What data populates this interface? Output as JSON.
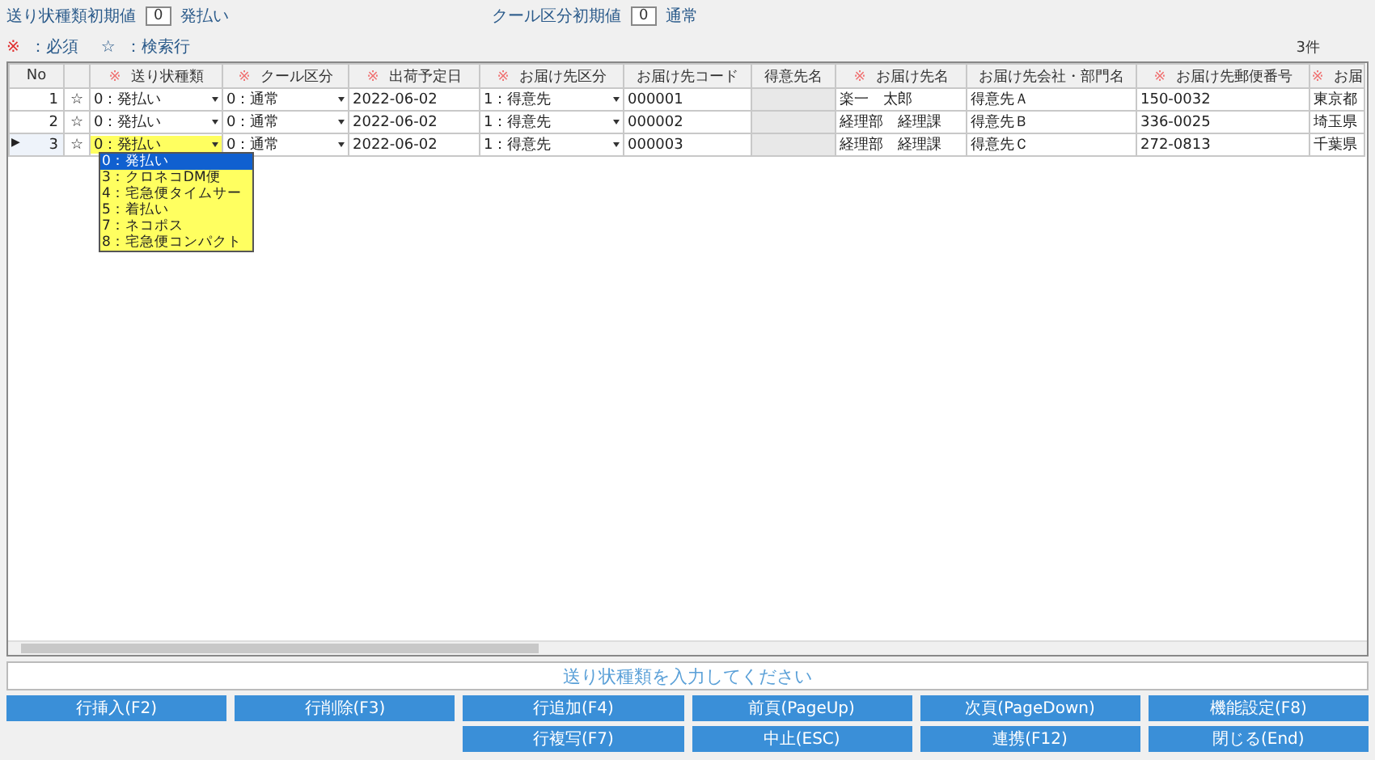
{
  "settings": [
    {
      "label": "送り状種類初期値",
      "value": "0",
      "text": "発払い"
    },
    {
      "label": "クール区分初期値",
      "value": "0",
      "text": "通常"
    }
  ],
  "legend": [
    {
      "mark": "※",
      "text": "：必須",
      "kind": "required"
    },
    {
      "mark": "☆",
      "text": "：検索行",
      "kind": "search"
    }
  ],
  "count": "3件",
  "current_marker": "▶",
  "columns": [
    {
      "label": "No"
    },
    {
      "label": "送り状種類",
      "mark": "※"
    },
    {
      "label": "クール区分",
      "mark": "※"
    },
    {
      "label": "出荷予定日",
      "mark": "※"
    },
    {
      "label": "お届け先区分",
      "mark": "※"
    },
    {
      "label": "お届け先コード"
    },
    {
      "label": "得意先名"
    },
    {
      "label": "お届け先名",
      "mark": "※"
    },
    {
      "label": "お届け先会社・部門名"
    },
    {
      "label": "お届け先郵便番号",
      "mark": "※"
    },
    {
      "label": "お届",
      "mark": "※"
    }
  ],
  "rows": [
    {
      "no": "1",
      "star": "☆",
      "selected": false,
      "cells": [
        {
          "text": "0：発払い",
          "kind": "combo"
        },
        {
          "text": "0：通常",
          "kind": "combo"
        },
        {
          "text": "2022-06-02",
          "kind": "text"
        },
        {
          "text": "1：得意先",
          "kind": "combo"
        },
        {
          "text": "000001",
          "kind": "text"
        },
        {
          "kind": "readonly"
        },
        {
          "text": "楽一　太郎",
          "kind": "text"
        },
        {
          "text": "得意先Ａ",
          "kind": "text"
        },
        {
          "text": "150-0032",
          "kind": "text"
        },
        {
          "text": "東京都",
          "kind": "text"
        }
      ]
    },
    {
      "no": "2",
      "star": "☆",
      "selected": false,
      "cells": [
        {
          "text": "0：発払い",
          "kind": "combo"
        },
        {
          "text": "0：通常",
          "kind": "combo"
        },
        {
          "text": "2022-06-02",
          "kind": "text"
        },
        {
          "text": "1：得意先",
          "kind": "combo"
        },
        {
          "text": "000002",
          "kind": "text"
        },
        {
          "kind": "readonly"
        },
        {
          "text": "経理部　経理課",
          "kind": "text"
        },
        {
          "text": "得意先Ｂ",
          "kind": "text"
        },
        {
          "text": "336-0025",
          "kind": "text"
        },
        {
          "text": "埼玉県",
          "kind": "text"
        }
      ]
    },
    {
      "no": "3",
      "star": "☆",
      "selected": true,
      "cells": [
        {
          "text": "0：発払い",
          "kind": "editing"
        },
        {
          "text": "0：通常",
          "kind": "combo"
        },
        {
          "text": "2022-06-02",
          "kind": "text"
        },
        {
          "text": "1：得意先",
          "kind": "combo"
        },
        {
          "text": "000003",
          "kind": "text"
        },
        {
          "kind": "readonly"
        },
        {
          "text": "経理部　経理課",
          "kind": "text"
        },
        {
          "text": "得意先Ｃ",
          "kind": "text"
        },
        {
          "text": "272-0813",
          "kind": "text"
        },
        {
          "text": "千葉県",
          "kind": "text"
        }
      ]
    }
  ],
  "dropdown": {
    "items": [
      {
        "label": "0：発払い",
        "selected": true
      },
      {
        "label": "3：クロネコDM便",
        "selected": false
      },
      {
        "label": "4：宅急便タイムサー",
        "selected": false
      },
      {
        "label": "5：着払い",
        "selected": false
      },
      {
        "label": "7：ネコポス",
        "selected": false
      },
      {
        "label": "8：宅急便コンパクト",
        "selected": false
      }
    ]
  },
  "message": "送り状種類を入力してください",
  "buttons": [
    [
      "行挿入(F2)",
      "行削除(F3)",
      "行追加(F4)",
      "前頁(PageUp)",
      "次頁(PageDown)",
      "機能設定(F8)"
    ],
    [
      "行複写(F7)",
      "中止(ESC)",
      "連携(F12)",
      "閉じる(End)"
    ]
  ]
}
